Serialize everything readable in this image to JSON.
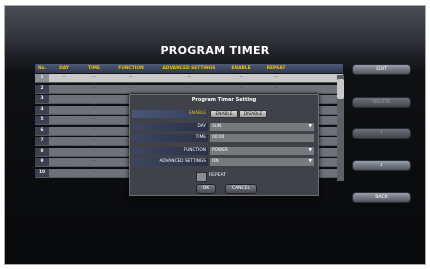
{
  "title": "PROGRAM TIMER",
  "table": {
    "headers": [
      "No.",
      "DAY",
      "TIME",
      "FUNCTION",
      "ADVANCED SETTINGS",
      "ENABLE",
      "REPEAT"
    ],
    "rows": [
      {
        "no": "1",
        "cells": [
          "--",
          "--",
          "--",
          "--",
          "--",
          "--"
        ]
      },
      {
        "no": "2",
        "cells": [
          "--",
          "--",
          "--",
          "--",
          "--",
          "--"
        ]
      },
      {
        "no": "3",
        "cells": [
          "--",
          "--",
          "--",
          "--",
          "--",
          "--"
        ]
      },
      {
        "no": "4",
        "cells": [
          "--",
          "--",
          "--",
          "--",
          "--",
          "--"
        ]
      },
      {
        "no": "5",
        "cells": [
          "--",
          "--",
          "--",
          "--",
          "--",
          "--"
        ]
      },
      {
        "no": "6",
        "cells": [
          "--",
          "--",
          "--",
          "--",
          "--",
          "--"
        ]
      },
      {
        "no": "7",
        "cells": [
          "--",
          "--",
          "--",
          "--",
          "--",
          "--"
        ]
      },
      {
        "no": "8",
        "cells": [
          "--",
          "--",
          "--",
          "--",
          "--",
          "--"
        ]
      },
      {
        "no": "9",
        "cells": [
          "--",
          "--",
          "--",
          "--",
          "--",
          "--"
        ]
      },
      {
        "no": "10",
        "cells": [
          "--",
          "--",
          "--",
          "--",
          "--",
          "--"
        ]
      }
    ]
  },
  "side_buttons": {
    "edit": "EDIT",
    "delete": "DELETE",
    "up": "↑",
    "down": "↓",
    "back": "BACK"
  },
  "dialog": {
    "title": "Program Timer Setting",
    "enable_label": "ENABLE",
    "enable_btn": "ENABLE",
    "disable_btn": "DISABLE",
    "day_label": "DAY",
    "day_value": "SUN",
    "time_label": "TIME",
    "time_value": "00:00",
    "function_label": "FUNCTION",
    "function_value": "POWER",
    "advanced_label": "ADVANCED SETTINGS",
    "advanced_value": "ON",
    "repeat_label": "REPEAT",
    "ok": "OK",
    "cancel": "CANCEL"
  }
}
